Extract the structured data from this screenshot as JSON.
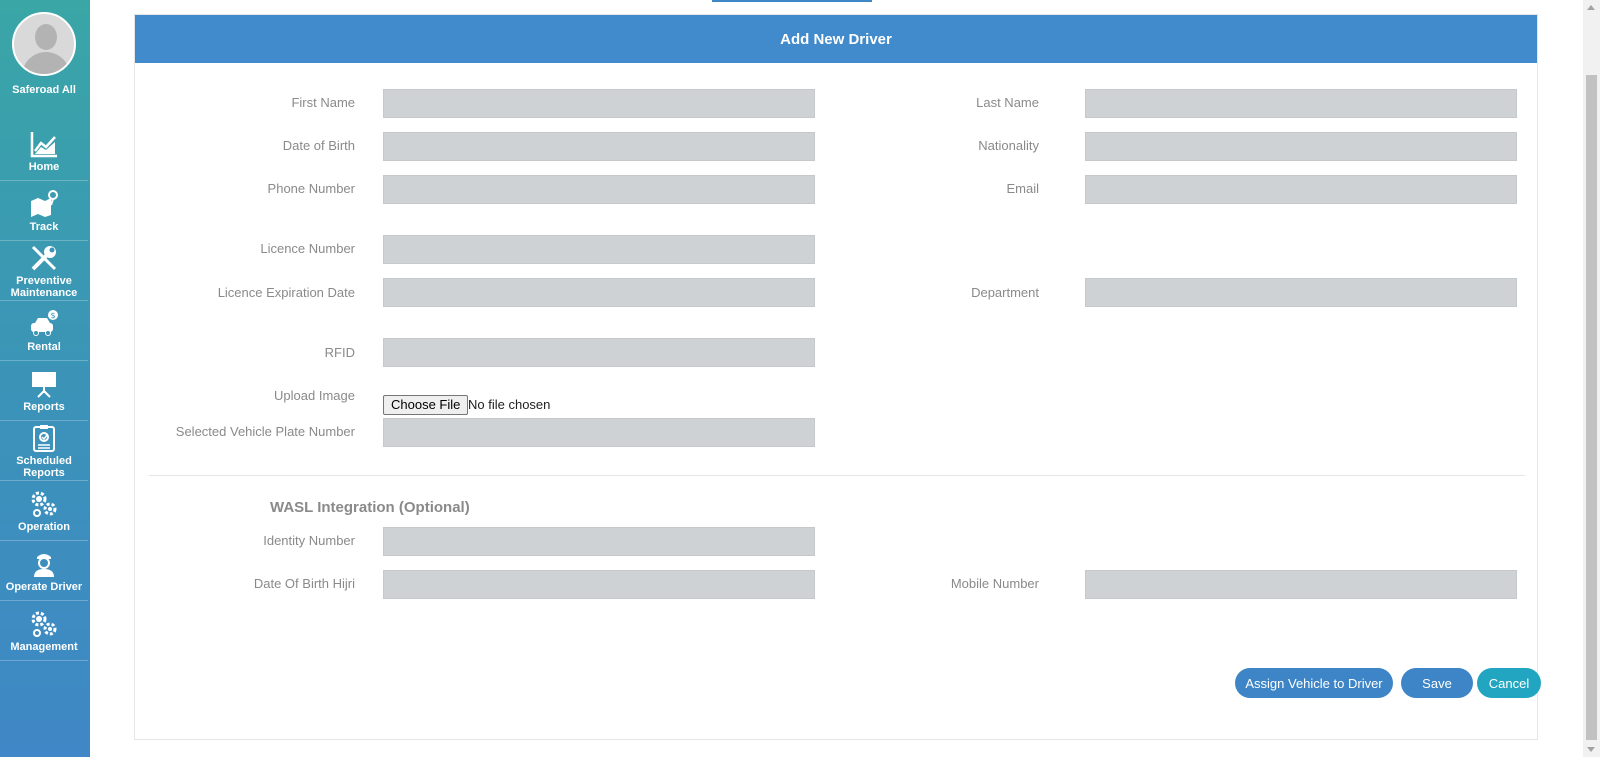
{
  "sidebar": {
    "user_name": "Saferoad All",
    "items": [
      {
        "label": "Home"
      },
      {
        "label": "Track"
      },
      {
        "label": "Preventive Maintenance"
      },
      {
        "label": "Rental"
      },
      {
        "label": "Reports"
      },
      {
        "label": "Scheduled Reports"
      },
      {
        "label": "Operation"
      },
      {
        "label": "Operate Driver"
      },
      {
        "label": "Management"
      }
    ]
  },
  "form": {
    "title": "Add New Driver",
    "first_name_label": "First Name",
    "last_name_label": "Last Name",
    "dob_label": "Date of Birth",
    "nationality_label": "Nationality",
    "phone_label": "Phone Number",
    "email_label": "Email",
    "licence_number_label": "Licence Number",
    "licence_expiration_label": "Licence Expiration Date",
    "department_label": "Department",
    "rfid_label": "RFID",
    "upload_image_label": "Upload Image",
    "choose_file_label": "Choose File",
    "no_file_text": "No file chosen",
    "selected_vehicle_label": "Selected Vehicle Plate Number",
    "wasl_title": "WASL Integration (Optional)",
    "identity_number_label": "Identity Number",
    "dob_hijri_label": "Date Of Birth Hijri",
    "mobile_number_label": "Mobile Number"
  },
  "actions": {
    "assign_label": "Assign Vehicle to Driver",
    "save_label": "Save",
    "cancel_label": "Cancel"
  },
  "colors": {
    "header": "#418acb",
    "primary_button": "#3d85c6",
    "cancel_button": "#22a5c0",
    "input_bg": "#cfd2d5"
  }
}
